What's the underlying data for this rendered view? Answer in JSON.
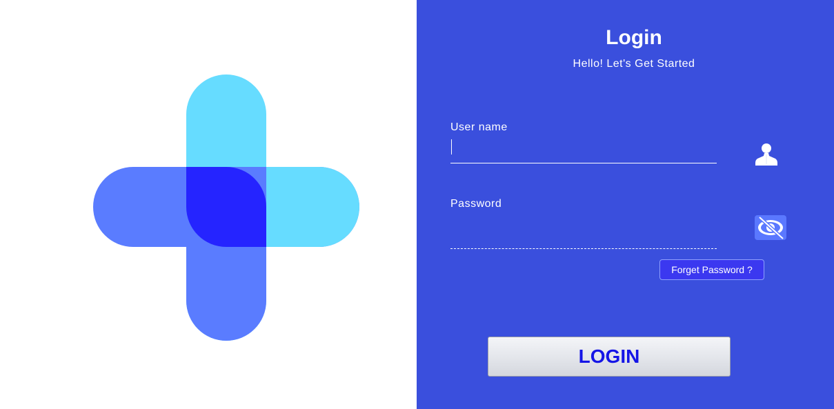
{
  "header": {
    "title": "Login",
    "subtitle": "Hello! Let's Get Started"
  },
  "form": {
    "username": {
      "label": "User name",
      "value": "",
      "icon": "user-icon"
    },
    "password": {
      "label": "Password",
      "value": "",
      "icon": "eye-slash-icon"
    },
    "forget_password_label": "Forget Password ?",
    "login_label": "LOGIN"
  },
  "colors": {
    "panel_background": "#3a4fdd",
    "login_text": "#1515e6",
    "logo_vertical": "#66dcff",
    "logo_horizontal": "#5a7cff",
    "logo_overlap": "#2524ff"
  }
}
